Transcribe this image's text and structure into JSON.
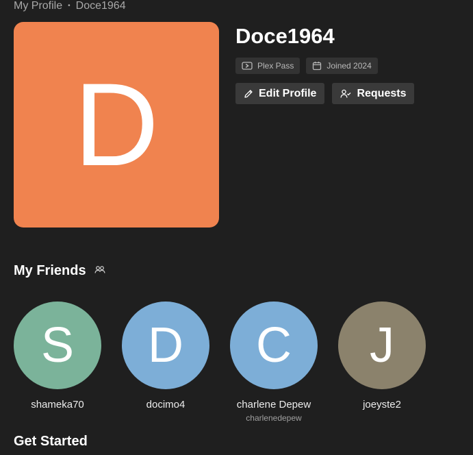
{
  "breadcrumb": {
    "root": "My Profile",
    "separator": "•",
    "current": "Doce1964"
  },
  "profile": {
    "initial": "D",
    "avatar_color": "#f0834f",
    "name": "Doce1964",
    "badges": [
      {
        "icon": "plex-pass-icon",
        "label": "Plex Pass"
      },
      {
        "icon": "calendar-icon",
        "label": "Joined 2024"
      }
    ],
    "actions": [
      {
        "icon": "pencil-icon",
        "label": "Edit Profile"
      },
      {
        "icon": "user-check-icon",
        "label": "Requests"
      }
    ]
  },
  "friends_section": {
    "title": "My Friends",
    "icon": "friends-icon",
    "friends": [
      {
        "initial": "S",
        "name": "shameka70",
        "username": "",
        "color": "#7bb39a"
      },
      {
        "initial": "D",
        "name": "docimo4",
        "username": "",
        "color": "#7daed7"
      },
      {
        "initial": "C",
        "name": "charlene Depew",
        "username": "charlenedepew",
        "color": "#7daed7"
      },
      {
        "initial": "J",
        "name": "joeyste2",
        "username": "",
        "color": "#8b826c"
      }
    ]
  },
  "get_started": {
    "title": "Get Started"
  }
}
